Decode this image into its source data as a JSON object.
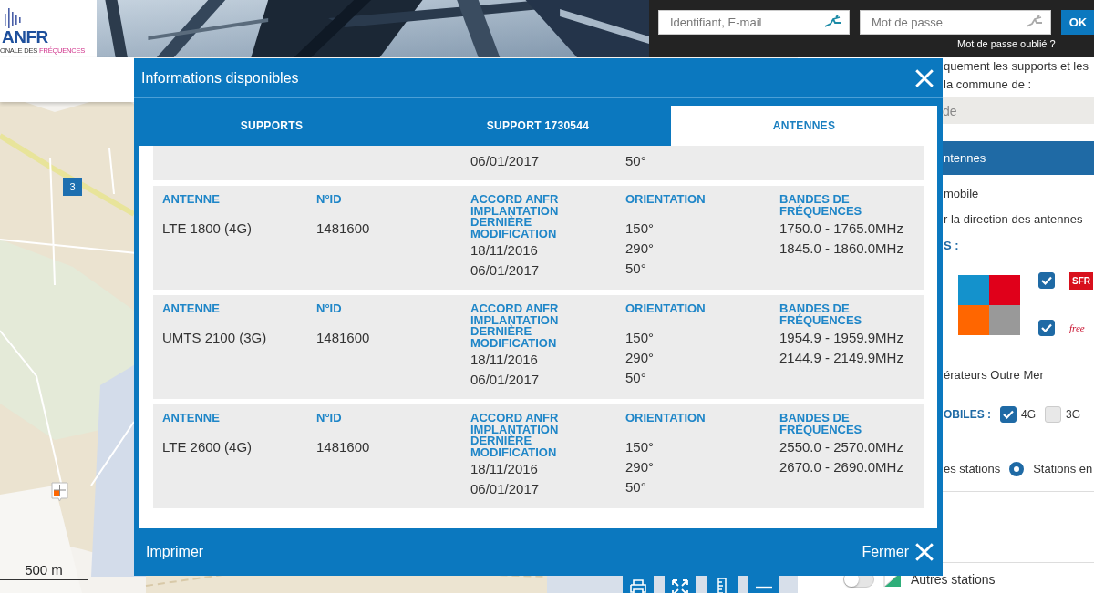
{
  "header": {
    "logo_text": "ANFR",
    "logo_subtitle": "ONALE DES",
    "logo_subtitle_accent": "FRÉQUENCES"
  },
  "login": {
    "username": {
      "placeholder": "Identifiant, E-mail"
    },
    "password": {
      "placeholder": "Mot de passe"
    },
    "submit": "OK",
    "forgot": "Mot de passe oublié ?"
  },
  "map": {
    "cluster_marker": "3",
    "scale": "500 m"
  },
  "side_panel": {
    "intro_lines": [
      "quement les supports et les",
      "la commune de :"
    ],
    "commune_field": {
      "placeholder": "de"
    },
    "section_header": "ntennes",
    "lines": [
      "mobile",
      "r la direction des antennes"
    ],
    "operators_label": "S :",
    "operators": [
      {
        "name": "SFR",
        "checked": true
      },
      {
        "name": "free",
        "checked": true
      }
    ],
    "overseas": "érateurs Outre Mer",
    "technologies": {
      "label": "OBILES :",
      "items": [
        {
          "label": "4G",
          "checked": true
        },
        {
          "label": "3G",
          "checked": false
        }
      ]
    },
    "stations_text": "es stations",
    "station_radio": {
      "label": "Stations en",
      "selected": true
    },
    "other_stations": {
      "label": "Autres stations",
      "on": false
    }
  },
  "dialog": {
    "title": "Informations disponibles",
    "tabs": [
      {
        "label": "SUPPORTS",
        "selected": false
      },
      {
        "label": "SUPPORT 1730544",
        "selected": false
      },
      {
        "label": "ANTENNES",
        "selected": true
      }
    ],
    "cards": [
      {
        "kind": "partial",
        "cells": [
          [],
          [],
          [
            "06/01/2017"
          ],
          [
            "50°"
          ],
          []
        ]
      },
      {
        "kind": "full",
        "headers": [
          "ANTENNE",
          "N°ID",
          "ACCORD ANFR IMPLANTATION DERNIÈRE MODIFICATION",
          "ORIENTATION",
          "BANDES DE FRÉQUENCES"
        ],
        "cells": [
          [
            "LTE 1800 (4G)"
          ],
          [
            "1481600"
          ],
          [
            "18/11/2016",
            "06/01/2017"
          ],
          [
            "150°",
            "290°",
            "50°"
          ],
          [
            "1750.0 - 1765.0MHz",
            "1845.0 - 1860.0MHz"
          ]
        ]
      },
      {
        "kind": "full",
        "headers": [
          "ANTENNE",
          "N°ID",
          "ACCORD ANFR IMPLANTATION DERNIÈRE MODIFICATION",
          "ORIENTATION",
          "BANDES DE FRÉQUENCES"
        ],
        "cells": [
          [
            "UMTS 2100 (3G)"
          ],
          [
            "1481600"
          ],
          [
            "18/11/2016",
            "06/01/2017"
          ],
          [
            "150°",
            "290°",
            "50°"
          ],
          [
            "1954.9 - 1959.9MHz",
            "2144.9 - 2149.9MHz"
          ]
        ]
      },
      {
        "kind": "full",
        "headers": [
          "ANTENNE",
          "N°ID",
          "ACCORD ANFR IMPLANTATION DERNIÈRE MODIFICATION",
          "ORIENTATION",
          "BANDES DE FRÉQUENCES"
        ],
        "cells": [
          [
            "LTE 2600 (4G)"
          ],
          [
            "1481600"
          ],
          [
            "18/11/2016",
            "06/01/2017"
          ],
          [
            "150°",
            "290°",
            "50°"
          ],
          [
            "2550.0 - 2570.0MHz",
            "2670.0 - 2690.0MHz"
          ]
        ]
      }
    ],
    "print": "Imprimer",
    "close": "Fermer"
  }
}
